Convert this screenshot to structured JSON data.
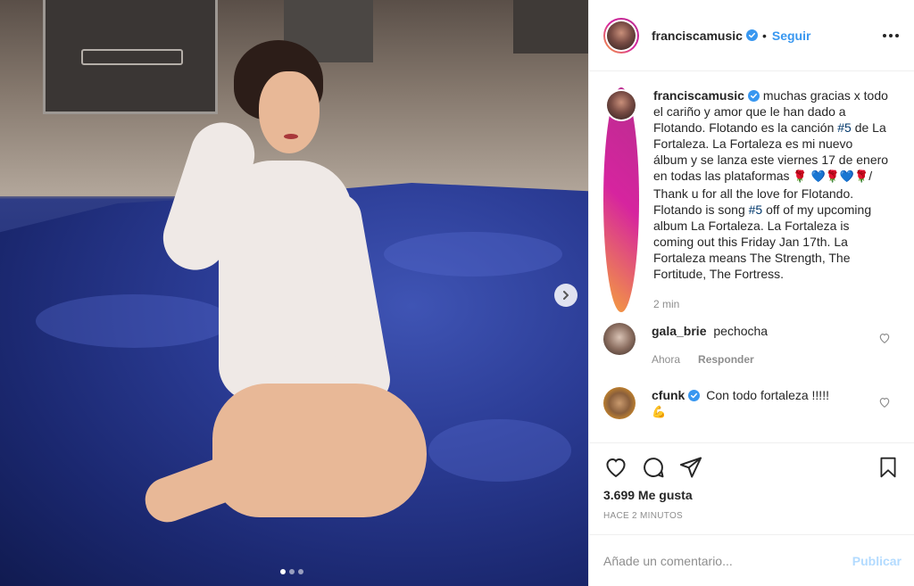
{
  "post": {
    "carousel": {
      "dots": 3,
      "active": 0
    }
  },
  "header": {
    "username": "franciscamusic",
    "separator": "•",
    "follow_label": "Seguir"
  },
  "caption": {
    "username": "franciscamusic",
    "text_1": "muchas gracias x todo el cariño y amor que le han dado a Flotando. Flotando es la canción ",
    "hashtag_1": "#5",
    "text_2": " de La Fortaleza. La Fortaleza es mi nuevo álbum y se lanza este viernes 17 de enero en todas las plataformas ",
    "emoji_1": "🌹",
    "emoji_row": "💙🌹💙🌹",
    "text_3": "/ Thank u for all the love for Flotando. Flotando is song ",
    "hashtag_2": "#5",
    "text_4": " off of my upcoming album La Fortaleza. La Fortaleza is coming out this Friday Jan 17th. La Fortaleza means The Strength, The Fortitude, The Fortress.",
    "time": "2 min"
  },
  "comments": [
    {
      "username": "gala_brie",
      "verified": false,
      "text": "pechocha",
      "time": "Ahora",
      "reply_label": "Responder"
    },
    {
      "username": "cfunk",
      "verified": true,
      "text": "Con todo fortaleza !!!!!",
      "emoji": "💪"
    }
  ],
  "actions": {
    "likes": "3.699 Me gusta",
    "timestamp": "HACE 2 MINUTOS"
  },
  "compose": {
    "placeholder": "Añade un comentario...",
    "publish_label": "Publicar"
  },
  "colors": {
    "link_blue": "#3897f0",
    "verified_blue": "#3897f0",
    "hashtag": "#00376b",
    "muted": "#8e8e8e",
    "publish_disabled": "#b3dbff"
  }
}
